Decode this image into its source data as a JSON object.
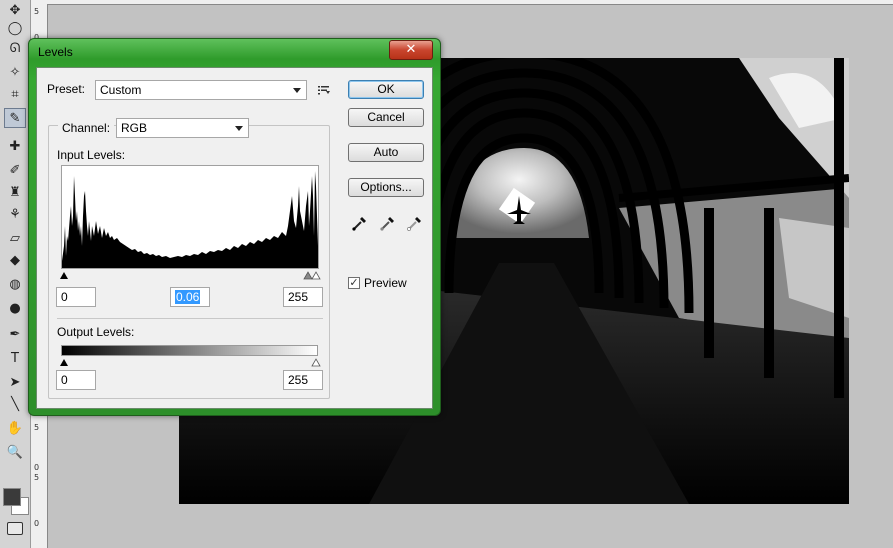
{
  "ruler": {
    "vertical_numbers": [
      "5",
      "0",
      "5",
      "0",
      "5",
      "0"
    ]
  },
  "tools": [
    {
      "name": "move-tool-icon",
      "glyph": "✥"
    },
    {
      "name": "lasso-ellipse-icon",
      "glyph": "◯"
    },
    {
      "name": "lasso-icon",
      "glyph": "ᘏ"
    },
    {
      "name": "magic-wand-icon",
      "glyph": "✧"
    },
    {
      "name": "crop-icon",
      "glyph": "⌗"
    },
    {
      "name": "eyedropper-tool-icon",
      "glyph": "✎"
    },
    {
      "name": "healing-brush-icon",
      "glyph": "✚"
    },
    {
      "name": "brush-icon",
      "glyph": "✐"
    },
    {
      "name": "stamp-icon",
      "glyph": "♜"
    },
    {
      "name": "history-brush-icon",
      "glyph": "⚘"
    },
    {
      "name": "eraser-icon",
      "glyph": "▱"
    },
    {
      "name": "paint-bucket-icon",
      "glyph": "◆"
    },
    {
      "name": "blur-icon",
      "glyph": "◍"
    },
    {
      "name": "dodge-icon",
      "glyph": "●"
    },
    {
      "name": "pen-icon",
      "glyph": "✒"
    },
    {
      "name": "type-icon",
      "glyph": "T"
    },
    {
      "name": "path-select-icon",
      "glyph": "➤"
    },
    {
      "name": "line-icon",
      "glyph": "╲"
    },
    {
      "name": "hand-icon",
      "glyph": "✋"
    },
    {
      "name": "zoom-icon",
      "glyph": "🔍"
    }
  ],
  "dialog": {
    "title": "Levels",
    "close_glyph": "✕",
    "preset_label": "Preset:",
    "preset_value": "Custom",
    "channel_label": "Channel:",
    "channel_value": "RGB",
    "input_levels_label": "Input Levels:",
    "input_black": "0",
    "input_gamma": "0.06",
    "input_white": "255",
    "output_levels_label": "Output Levels:",
    "output_black": "0",
    "output_white": "255",
    "buttons": {
      "ok": "OK",
      "cancel": "Cancel",
      "auto": "Auto",
      "options": "Options..."
    },
    "preview_label": "Preview",
    "preview_checked": true,
    "check_glyph": "✓"
  },
  "colors": {
    "dialog_frame": "#36a832",
    "ok_border": "#3c7fb1",
    "selection": "#3399ff",
    "close_button": "#c9452e"
  }
}
